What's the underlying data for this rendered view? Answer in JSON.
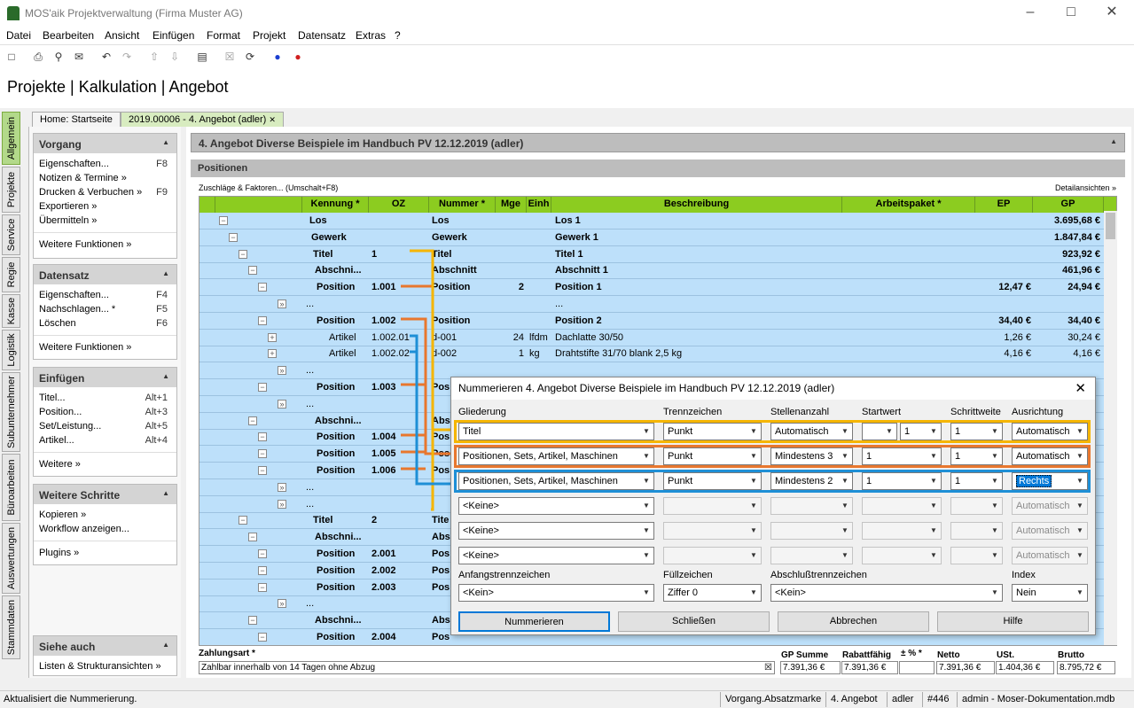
{
  "window": {
    "title": "MOS'aik Projektverwaltung (Firma Muster AG)"
  },
  "menu": [
    "Datei",
    "Bearbeiten",
    "Ansicht",
    "Einfügen",
    "Format",
    "Projekt",
    "Datensatz",
    "Extras",
    "?"
  ],
  "heading": "Projekte | Kalkulation | Angebot",
  "vtabs": [
    "Allgemein",
    "Projekte",
    "Service",
    "Regie",
    "Kasse",
    "Logistik",
    "Subunternehmer",
    "Büroarbeiten",
    "Auswertungen",
    "Stammdaten"
  ],
  "doctabs": {
    "home": "Home: Startseite",
    "active": "2019.00006 - 4. Angebot (adler)",
    "close": "✕"
  },
  "leftpanel": {
    "vorgang": {
      "title": "Vorgang",
      "items": [
        {
          "l": "Eigenschaften...",
          "k": "F8"
        },
        {
          "l": "Notizen & Termine »",
          "k": ""
        },
        {
          "l": "Drucken & Verbuchen »",
          "k": "F9"
        },
        {
          "l": "Exportieren »",
          "k": ""
        },
        {
          "l": "Übermitteln »",
          "k": ""
        }
      ],
      "more": "Weitere Funktionen »"
    },
    "datensatz": {
      "title": "Datensatz",
      "items": [
        {
          "l": "Eigenschaften...",
          "k": "F4"
        },
        {
          "l": "Nachschlagen... *",
          "k": "F5"
        },
        {
          "l": "Löschen",
          "k": "F6"
        }
      ],
      "more": "Weitere Funktionen »"
    },
    "einfuegen": {
      "title": "Einfügen",
      "items": [
        {
          "l": "Titel...",
          "k": "Alt+1"
        },
        {
          "l": "Position...",
          "k": "Alt+3"
        },
        {
          "l": "Set/Leistung...",
          "k": "Alt+5"
        },
        {
          "l": "Artikel...",
          "k": "Alt+4"
        }
      ],
      "more": "Weitere »"
    },
    "schritte": {
      "title": "Weitere Schritte",
      "items": [
        "Kopieren »",
        "Workflow anzeigen..."
      ],
      "more": "Plugins »"
    },
    "siehe": {
      "title": "Siehe auch",
      "items": [
        "Listen & Strukturansichten »"
      ]
    }
  },
  "infobar": "4. Angebot Diverse Beispiele im Handbuch PV 12.12.2019 (adler)",
  "positionen": {
    "title": "Positionen",
    "zuschlaege": "Zuschläge & Faktoren... (Umschalt+F8)",
    "detail": "Detailansichten »"
  },
  "grid": {
    "columns": [
      "Kennung *",
      "OZ",
      "Nummer *",
      "Mge",
      "Einh",
      "Beschreibung",
      "Arbeitspaket *",
      "EP",
      "GP"
    ],
    "rows": [
      {
        "k": "Los",
        "oz": "",
        "n": "Los",
        "m": "",
        "e": "",
        "d": "Los 1",
        "ep": "",
        "gp": "3.695,68 €",
        "b": true
      },
      {
        "k": "Gewerk",
        "oz": "",
        "n": "Gewerk",
        "m": "",
        "e": "",
        "d": "Gewerk 1",
        "ep": "",
        "gp": "1.847,84 €",
        "b": true
      },
      {
        "k": "Titel",
        "oz": "1",
        "n": "Titel",
        "m": "",
        "e": "",
        "d": "Titel 1",
        "ep": "",
        "gp": "923,92 €",
        "b": true
      },
      {
        "k": "Abschni...",
        "oz": "",
        "n": "Abschnitt",
        "m": "",
        "e": "",
        "d": "Abschnitt 1",
        "ep": "",
        "gp": "461,96 €",
        "b": true
      },
      {
        "k": "Position",
        "oz": "1.001",
        "n": "Position",
        "m": "2",
        "e": "",
        "d": "Position 1",
        "ep": "12,47 €",
        "gp": "24,94 €",
        "b": true
      },
      {
        "k": "...",
        "oz": "",
        "n": "",
        "m": "",
        "e": "",
        "d": "...",
        "ep": "",
        "gp": "",
        "b": false
      },
      {
        "k": "Position",
        "oz": "1.002",
        "n": "Position",
        "m": "",
        "e": "",
        "d": "Position 2",
        "ep": "34,40 €",
        "gp": "34,40 €",
        "b": true
      },
      {
        "k": "Artikel",
        "oz": "1.002.01",
        "n": "d-001",
        "m": "24",
        "e": "lfdm",
        "d": "Dachlatte 30/50",
        "ep": "1,26 €",
        "gp": "30,24 €",
        "b": false
      },
      {
        "k": "Artikel",
        "oz": "1.002.02",
        "n": "d-002",
        "m": "1",
        "e": "kg",
        "d": "Drahtstifte 31/70 blank 2,5 kg",
        "ep": "4,16 €",
        "gp": "4,16 €",
        "b": false
      },
      {
        "k": "...",
        "oz": "",
        "n": "",
        "m": "",
        "e": "",
        "d": "",
        "ep": "",
        "gp": "",
        "b": false
      },
      {
        "k": "Position",
        "oz": "1.003",
        "n": "Pos",
        "m": "",
        "e": "",
        "d": "",
        "ep": "",
        "gp": "",
        "b": true
      },
      {
        "k": "...",
        "oz": "",
        "n": "",
        "m": "",
        "e": "",
        "d": "",
        "ep": "",
        "gp": "",
        "b": false
      },
      {
        "k": "Abschni...",
        "oz": "",
        "n": "Abs",
        "m": "",
        "e": "",
        "d": "",
        "ep": "",
        "gp": "",
        "b": true
      },
      {
        "k": "Position",
        "oz": "1.004",
        "n": "Pos",
        "m": "",
        "e": "",
        "d": "",
        "ep": "",
        "gp": "",
        "b": true
      },
      {
        "k": "Position",
        "oz": "1.005",
        "n": "Pos",
        "m": "",
        "e": "",
        "d": "",
        "ep": "",
        "gp": "",
        "b": true
      },
      {
        "k": "Position",
        "oz": "1.006",
        "n": "Pos",
        "m": "",
        "e": "",
        "d": "",
        "ep": "",
        "gp": "",
        "b": true
      },
      {
        "k": "...",
        "oz": "",
        "n": "",
        "m": "",
        "e": "",
        "d": "",
        "ep": "",
        "gp": "",
        "b": false
      },
      {
        "k": "...",
        "oz": "",
        "n": "",
        "m": "",
        "e": "",
        "d": "",
        "ep": "",
        "gp": "",
        "b": false
      },
      {
        "k": "Titel",
        "oz": "2",
        "n": "Tite",
        "m": "",
        "e": "",
        "d": "",
        "ep": "",
        "gp": "",
        "b": true
      },
      {
        "k": "Abschni...",
        "oz": "",
        "n": "Abs",
        "m": "",
        "e": "",
        "d": "",
        "ep": "",
        "gp": "",
        "b": true
      },
      {
        "k": "Position",
        "oz": "2.001",
        "n": "Pos",
        "m": "",
        "e": "",
        "d": "",
        "ep": "",
        "gp": "",
        "b": true
      },
      {
        "k": "Position",
        "oz": "2.002",
        "n": "Pos",
        "m": "",
        "e": "",
        "d": "",
        "ep": "",
        "gp": "",
        "b": true
      },
      {
        "k": "Position",
        "oz": "2.003",
        "n": "Pos",
        "m": "",
        "e": "",
        "d": "",
        "ep": "",
        "gp": "",
        "b": true
      },
      {
        "k": "...",
        "oz": "",
        "n": "",
        "m": "",
        "e": "",
        "d": "",
        "ep": "",
        "gp": "",
        "b": false
      },
      {
        "k": "Abschni...",
        "oz": "",
        "n": "Abs",
        "m": "",
        "e": "",
        "d": "",
        "ep": "",
        "gp": "",
        "b": true
      },
      {
        "k": "Position",
        "oz": "2.004",
        "n": "Pos",
        "m": "",
        "e": "",
        "d": "",
        "ep": "",
        "gp": "",
        "b": true
      }
    ]
  },
  "footer": {
    "zahlungsart_label": "Zahlungsart *",
    "zahlungsart": "Zahlbar innerhalb von 14 Tagen ohne Abzug",
    "gpsumme_label": "GP Summe",
    "gpsumme": "7.391,36 €",
    "rabatt_label": "Rabattfähig",
    "rabatt": "7.391,36 €",
    "pct_label": "± % *",
    "netto_label": "Netto",
    "netto": "7.391,36 €",
    "ust_label": "USt.",
    "ust": "1.404,36 €",
    "brutto_label": "Brutto",
    "brutto": "8.795,72 €"
  },
  "dialog": {
    "title": "Nummerieren 4. Angebot Diverse Beispiele im Handbuch PV 12.12.2019 (adler)",
    "headers": [
      "Gliederung",
      "Trennzeichen",
      "Stellenanzahl",
      "Startwert",
      "Schrittweite",
      "Ausrichtung"
    ],
    "rows": [
      {
        "g": "Titel",
        "t": "Punkt",
        "s": "Automatisch",
        "sw1": "",
        "sw2": "1",
        "sch": "1",
        "a": "Automatisch",
        "enabled": true
      },
      {
        "g": "Positionen, Sets, Artikel, Maschinen",
        "t": "Punkt",
        "s": "Mindestens 3",
        "sw1": "1",
        "sw2": "",
        "sch": "1",
        "a": "Automatisch",
        "enabled": true
      },
      {
        "g": "Positionen, Sets, Artikel, Maschinen",
        "t": "Punkt",
        "s": "Mindestens 2",
        "sw1": "1",
        "sw2": "",
        "sch": "1",
        "a": "Rechts",
        "enabled": true
      },
      {
        "g": "<Keine>",
        "t": "",
        "s": "",
        "sw1": "",
        "sw2": "",
        "sch": "",
        "a": "Automatisch",
        "enabled": false
      },
      {
        "g": "<Keine>",
        "t": "",
        "s": "",
        "sw1": "",
        "sw2": "",
        "sch": "",
        "a": "Automatisch",
        "enabled": false
      },
      {
        "g": "<Keine>",
        "t": "",
        "s": "",
        "sw1": "",
        "sw2": "",
        "sch": "",
        "a": "Automatisch",
        "enabled": false
      }
    ],
    "lower": {
      "anf_label": "Anfangstrennzeichen",
      "anf": "<Kein>",
      "fuell_label": "Füllzeichen",
      "fuell": "Ziffer 0",
      "abschl_label": "Abschlußtrennzeichen",
      "abschl": "<Kein>",
      "index_label": "Index",
      "index": "Nein"
    },
    "buttons": [
      "Nummerieren",
      "Schließen",
      "Abbrechen",
      "Hilfe"
    ],
    "colors": {
      "row1": "#f5b500",
      "row2": "#e8772e",
      "row3": "#1e8fd6"
    }
  },
  "status": {
    "msg": "Aktualisiert die Nummerierung.",
    "cells": [
      "Vorgang.Absatzmarke",
      "4. Angebot",
      "adler",
      "#446",
      "admin - Moser-Dokumentation.mdb"
    ]
  }
}
